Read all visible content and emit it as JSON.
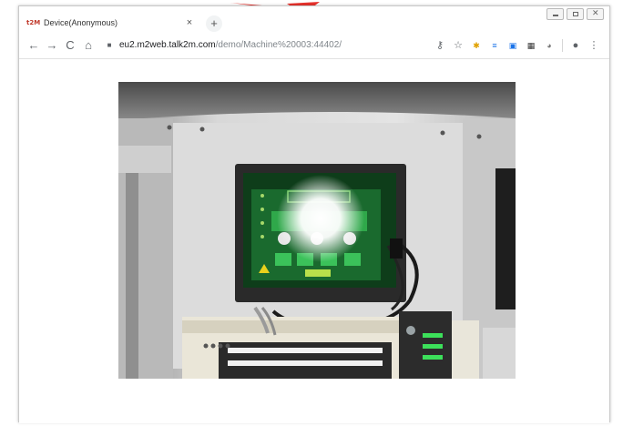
{
  "tab": {
    "favicon_text": "t2M",
    "title": "Device(Anonymous)",
    "close_glyph": "×",
    "new_tab_glyph": "+"
  },
  "toolbar": {
    "back_glyph": "←",
    "forward_glyph": "→",
    "reload_glyph": "C",
    "home_glyph": "⌂",
    "url_host": "eu2.m2web.talk2m.com",
    "url_path": "/demo/Machine%20003:44402/",
    "key_glyph": "⚷",
    "star_glyph": "☆",
    "menu_glyph": "⋮",
    "profile_glyph": "●"
  },
  "colors": {
    "accent_red": "#e8322d",
    "hmi_green": "#2fa84a",
    "hmi_screen": "#1a6a2e"
  },
  "icons": [
    "key-icon",
    "bookmark-star-icon",
    "extension-icon",
    "profile-icon",
    "menu-icon"
  ]
}
